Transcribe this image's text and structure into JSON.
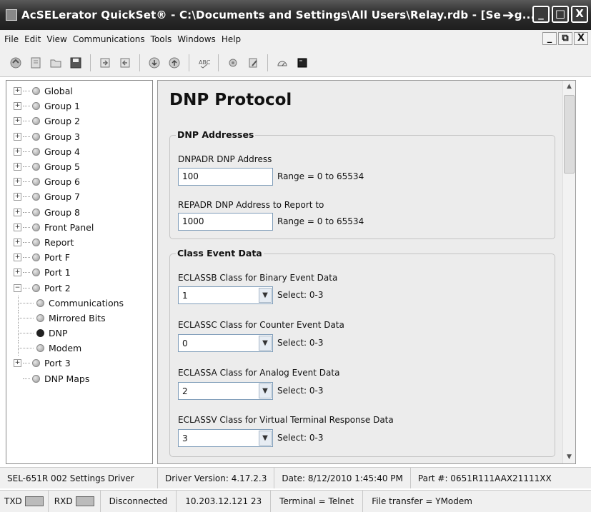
{
  "window": {
    "title": "AcSELerator QuickSet® - C:\\Documents and Settings\\All Users\\Relay.rdb - [Se",
    "title_tail": "g...",
    "minimize": "_",
    "maximize": "□",
    "close": "X"
  },
  "menu": {
    "items": [
      "File",
      "Edit",
      "View",
      "Communications",
      "Tools",
      "Windows",
      "Help"
    ],
    "mdi_minimize": "_",
    "mdi_restore": "⧉",
    "mdi_close": "X"
  },
  "toolbar": {
    "icons": [
      "open-icon",
      "new-icon",
      "folder-icon",
      "save-icon",
      "send-icon",
      "receive-icon",
      "down-arrow-icon",
      "up-arrow-icon",
      "spellcheck-icon",
      "settings-icon",
      "edit-icon",
      "hmi-icon",
      "terminal-icon"
    ]
  },
  "tree": {
    "items": [
      {
        "label": "Global",
        "expander": "+"
      },
      {
        "label": "Group 1",
        "expander": "+"
      },
      {
        "label": "Group 2",
        "expander": "+"
      },
      {
        "label": "Group 3",
        "expander": "+"
      },
      {
        "label": "Group 4",
        "expander": "+"
      },
      {
        "label": "Group 5",
        "expander": "+"
      },
      {
        "label": "Group 6",
        "expander": "+"
      },
      {
        "label": "Group 7",
        "expander": "+"
      },
      {
        "label": "Group 8",
        "expander": "+"
      },
      {
        "label": "Front Panel",
        "expander": "+"
      },
      {
        "label": "Report",
        "expander": "+"
      },
      {
        "label": "Port F",
        "expander": "+"
      },
      {
        "label": "Port 1",
        "expander": "+"
      },
      {
        "label": "Port 2",
        "expander": "−"
      },
      {
        "label": "Communications",
        "child": true
      },
      {
        "label": "Mirrored Bits",
        "child": true
      },
      {
        "label": "DNP",
        "child": true,
        "selected": true
      },
      {
        "label": "Modem",
        "child": true
      },
      {
        "label": "Port 3",
        "expander": "+"
      },
      {
        "label": "DNP Maps",
        "expander": ""
      }
    ]
  },
  "main": {
    "title": "DNP Protocol",
    "addresses": {
      "legend": "DNP Addresses",
      "dnpadr_label": "DNPADR  DNP Address",
      "dnpadr_value": "100",
      "dnpadr_range": "Range = 0 to 65534",
      "repadr_label": "REPADR  DNP Address to Report to",
      "repadr_value": "1000",
      "repadr_range": "Range = 0 to 65534"
    },
    "class_event": {
      "legend": "Class Event Data",
      "eclassb_label": "ECLASSB  Class for Binary Event Data",
      "eclassb_value": "1",
      "eclassb_hint": "Select: 0-3",
      "eclassc_label": "ECLASSC  Class for Counter Event Data",
      "eclassc_value": "0",
      "eclassc_hint": "Select: 0-3",
      "eclassa_label": "ECLASSA  Class for Analog Event Data",
      "eclassa_value": "2",
      "eclassa_hint": "Select: 0-3",
      "eclassv_label": "ECLASSV  Class for Virtual Terminal Response Data",
      "eclassv_value": "3",
      "eclassv_hint": "Select: 0-3"
    }
  },
  "status": {
    "driver": "SEL-651R 002 Settings Driver",
    "version": "Driver Version: 4.17.2.3",
    "date": "Date: 8/12/2010 1:45:40 PM",
    "part": "Part #: 0651R111AAX21111XX",
    "txd": "TXD",
    "rxd": "RXD",
    "connection": "Disconnected",
    "address": "10.203.12.121  23",
    "terminal": "Terminal = Telnet",
    "transfer": "File transfer = YModem"
  }
}
